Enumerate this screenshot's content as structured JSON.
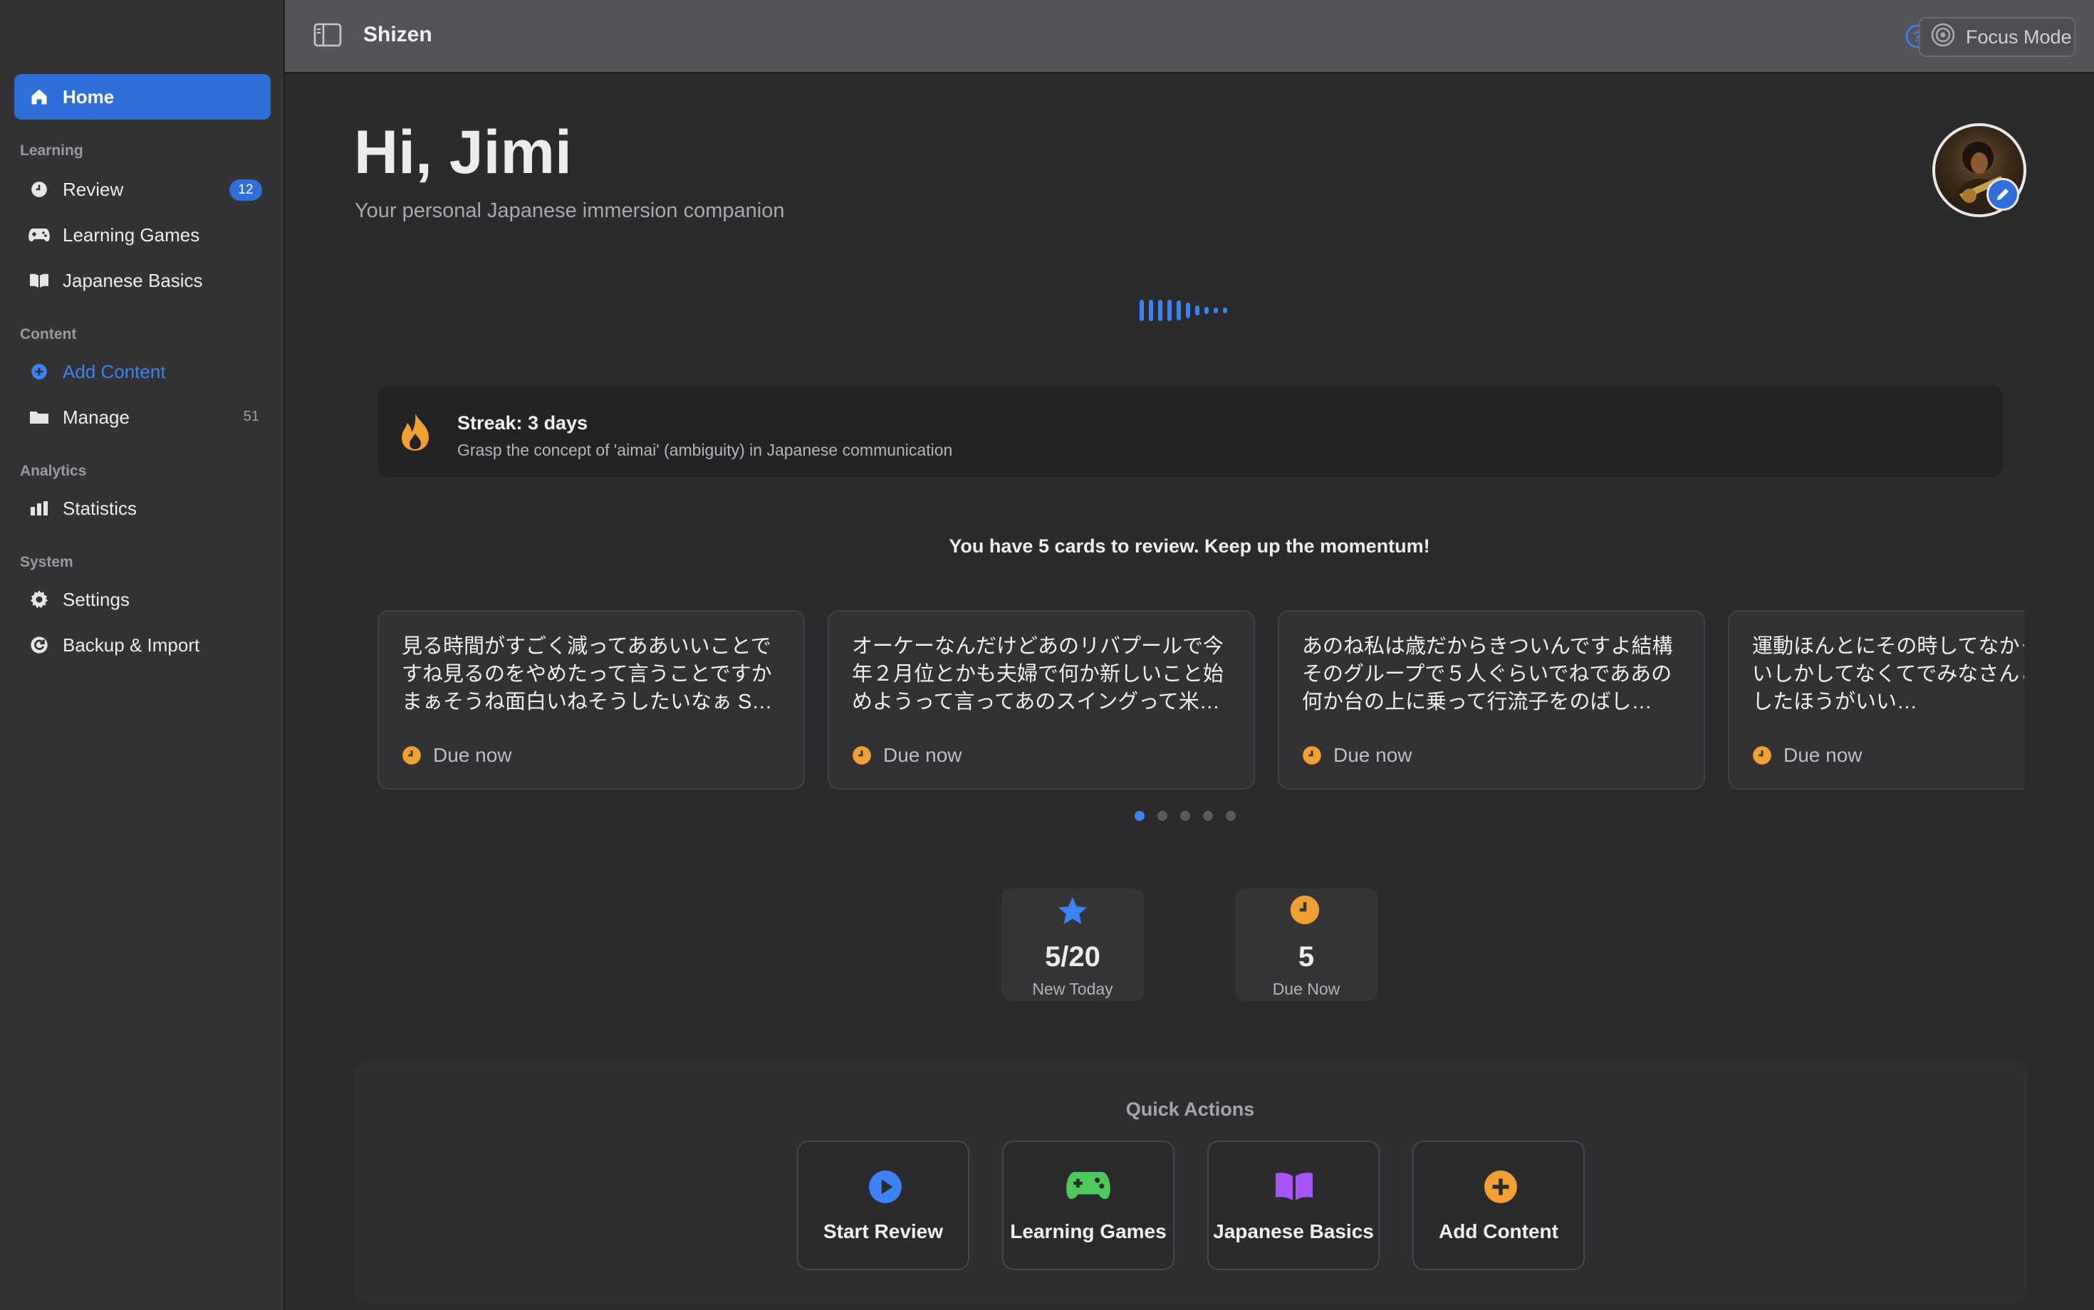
{
  "app": {
    "title": "Shizen"
  },
  "topbar": {
    "focus_label": "Focus Mode"
  },
  "sidebar": {
    "home": "Home",
    "sections": {
      "learning": "Learning",
      "content": "Content",
      "analytics": "Analytics",
      "system": "System"
    },
    "items": {
      "review": {
        "label": "Review",
        "badge": "12"
      },
      "learning_games": {
        "label": "Learning Games"
      },
      "japanese_basics": {
        "label": "Japanese Basics"
      },
      "add_content": {
        "label": "Add Content"
      },
      "manage": {
        "label": "Manage",
        "count": "51"
      },
      "statistics": {
        "label": "Statistics"
      },
      "settings": {
        "label": "Settings"
      },
      "backup": {
        "label": "Backup & Import"
      }
    }
  },
  "main": {
    "greeting": "Hi, Jimi",
    "subtitle": "Your personal Japanese immersion companion",
    "streak": {
      "title": "Streak: 3 days",
      "subtitle": "Grasp the concept of 'aimai' (ambiguity) in Japanese communication"
    },
    "review_message": "You have 5 cards to review. Keep up the momentum!",
    "cards": [
      {
        "text": "見る時間がすごく減ってああいいことですね見るのをやめたって言うことですかまぁそうね面白いねそうしたいなぁ S…",
        "due": "Due now"
      },
      {
        "text": "オーケーなんだけどあのリバプールで今年２月位とかも夫婦で何か新しいこと始めようって言ってあのスイングって米…",
        "due": "Due now"
      },
      {
        "text": "あのね私は歳だからきついんですよ結構そのグループで５人ぐらいでねでああの何か台の上に乗って行流子をのばし…",
        "due": "Due now"
      },
      {
        "text": "運動ほんとにその時してなかったくぐらいしかしてなくてでみなさんとかにヨガしたほうがいい…",
        "due": "Due now"
      }
    ],
    "carousel": {
      "pages": 5,
      "current": 1
    },
    "stats": {
      "new_today": {
        "value": "5/20",
        "label": "New Today"
      },
      "due_now": {
        "value": "5",
        "label": "Due Now"
      }
    },
    "quick_actions": {
      "title": "Quick Actions",
      "start_review": "Start Review",
      "learning_games": "Learning Games",
      "japanese_basics": "Japanese Basics",
      "add_content": "Add Content"
    }
  },
  "colors": {
    "accent": "#2f6fd9",
    "link": "#3b82f6",
    "orange": "#f0a030",
    "green": "#4cc95a",
    "purple": "#a855f7"
  },
  "icons": {
    "home": "house-icon",
    "review": "clock-icon",
    "games": "gamepad-icon",
    "basics": "book-icon",
    "add": "plus-circle-icon",
    "manage": "folder-icon",
    "statistics": "bar-chart-icon",
    "settings": "gear-icon",
    "backup": "backup-icon",
    "streak": "flame-icon",
    "new_today": "star-icon",
    "due": "clock-icon",
    "start_review": "play-circle-icon"
  }
}
